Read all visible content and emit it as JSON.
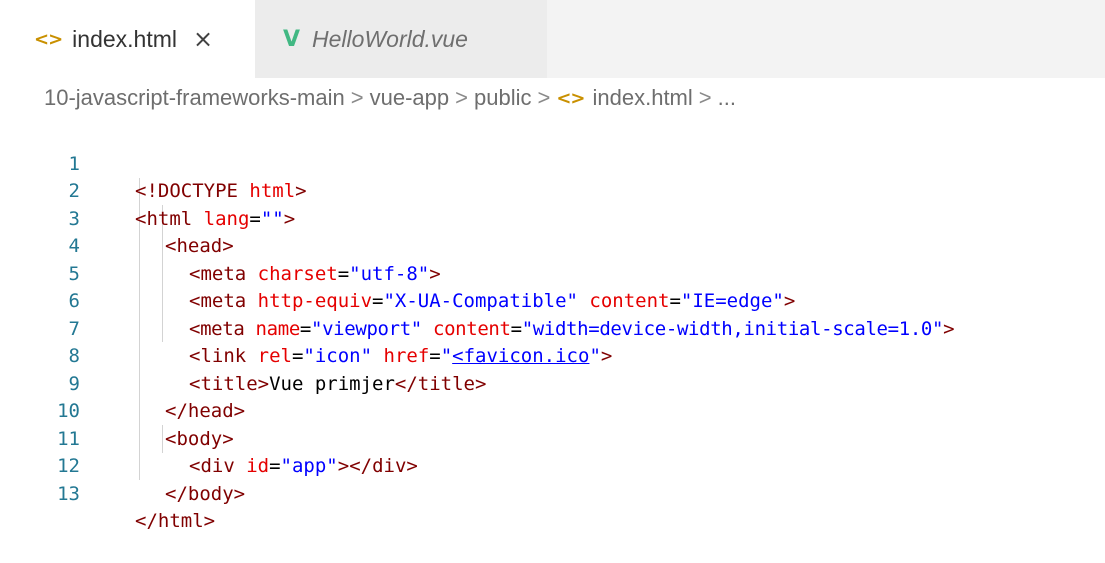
{
  "tabs": [
    {
      "label": "index.html",
      "active": true,
      "icon": "html-file-icon",
      "close": "×"
    },
    {
      "label": "HelloWorld.vue",
      "active": false,
      "icon": "vue-file-icon"
    }
  ],
  "breadcrumb": {
    "items": [
      "10-javascript-frameworks-main",
      "vue-app",
      "public",
      "index.html",
      "..."
    ],
    "separator": ">"
  },
  "code": {
    "lines": [
      {
        "n": "1",
        "t1": "<!DOCTYPE ",
        "t2": "html",
        "t3": ">"
      },
      {
        "n": "2",
        "t1": "<html ",
        "a1": "lang",
        "e1": "=",
        "s1": "\"\"",
        "t3": ">"
      },
      {
        "n": "3",
        "t1": "<head>"
      },
      {
        "n": "4",
        "t1": "<meta ",
        "a1": "charset",
        "e1": "=",
        "s1": "\"utf-8\"",
        "t3": ">"
      },
      {
        "n": "5",
        "t1": "<meta ",
        "a1": "http-equiv",
        "e1": "=",
        "s1": "\"X-UA-Compatible\"",
        "a2": " content",
        "e2": "=",
        "s2": "\"IE=edge\"",
        "t3": ">"
      },
      {
        "n": "6",
        "t1": "<meta ",
        "a1": "name",
        "e1": "=",
        "s1": "\"viewport\"",
        "a2": " content",
        "e2": "=",
        "s2": "\"width=device-width,initial-scale=1.0\"",
        "t3": ">"
      },
      {
        "n": "7",
        "t1": "<link ",
        "a1": "rel",
        "e1": "=",
        "s1": "\"icon\"",
        "a2": " href",
        "e2": "=",
        "q1": "\"",
        "link": "<favicon.ico",
        "q2": "\"",
        "t3": ">"
      },
      {
        "n": "8",
        "t1": "<title>",
        "txt": "Vue primjer",
        "t3": "</title>"
      },
      {
        "n": "9",
        "t1": "</head>"
      },
      {
        "n": "10",
        "t1": "<body>"
      },
      {
        "n": "11",
        "t1": "<div ",
        "a1": "id",
        "e1": "=",
        "s1": "\"app\"",
        "t3": "></div>"
      },
      {
        "n": "12",
        "t1": "</body>"
      },
      {
        "n": "13",
        "t1": "</html>"
      }
    ]
  },
  "colors": {
    "line_number": "#237893",
    "tag": "#800000",
    "attribute": "#e50000",
    "string": "#0000ff",
    "tab_bar_bg": "#f3f3f3"
  }
}
